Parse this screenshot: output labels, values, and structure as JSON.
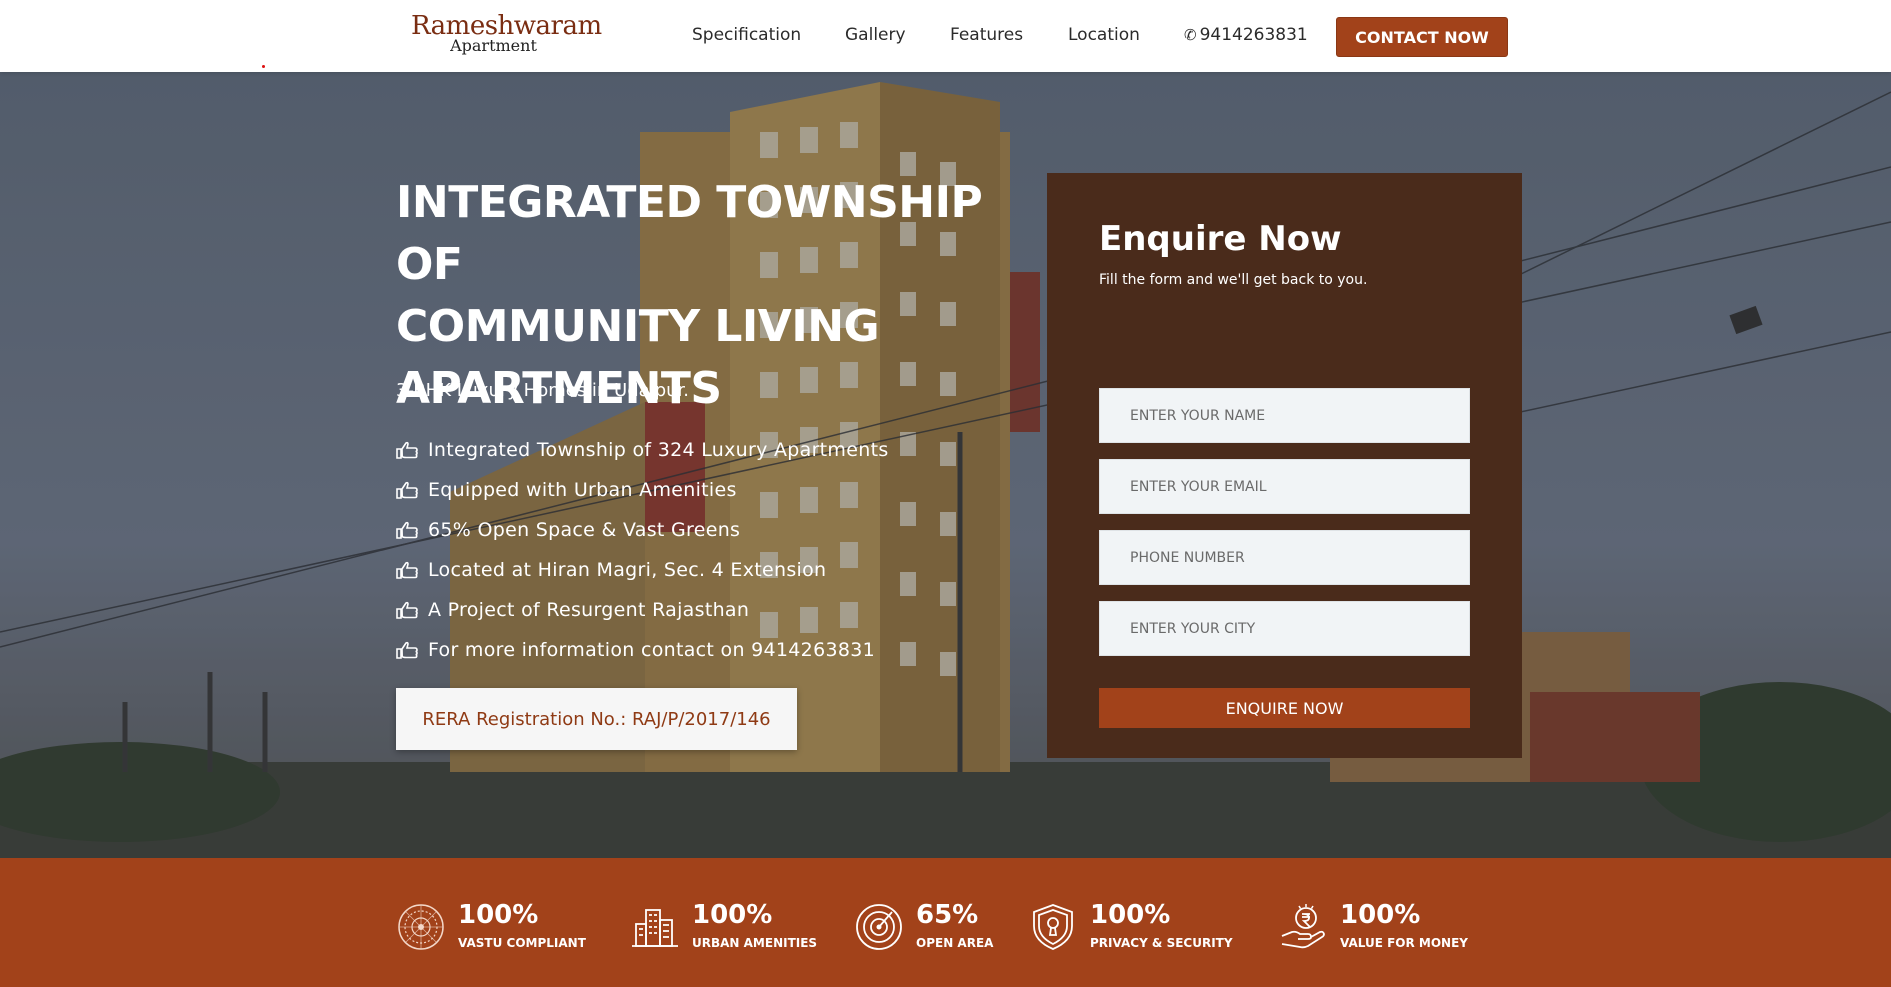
{
  "brand": {
    "name": "Rameshwaram",
    "subtitle": "Apartment"
  },
  "nav": {
    "items": [
      "Specification",
      "Gallery",
      "Features",
      "Location"
    ],
    "phone": "9414263831",
    "contact_label": "CONTACT NOW"
  },
  "hero": {
    "title_lines": [
      "INTEGRATED TOWNSHIP OF",
      "COMMUNITY LIVING",
      "APARTMENTS"
    ],
    "subtitle": "3-BHK Luxury Homes in Udaipur.",
    "features": [
      "Integrated Township of 324 Luxury Apartments",
      "Equipped with Urban Amenities",
      "65% Open Space & Vast Greens",
      "Located at Hiran Magri, Sec. 4 Extension",
      "A Project of Resurgent Rajasthan",
      "For more information contact on 9414263831"
    ],
    "feature_icon": "pointing-hand-icon",
    "rera": "RERA Registration No.: RAJ/P/2017/146"
  },
  "form": {
    "title": "Enquire Now",
    "subtitle": "Fill the form and we'll get back to you.",
    "name_placeholder": "ENTER YOUR NAME",
    "email_placeholder": "ENTER YOUR EMAIL",
    "phone_placeholder": "PHONE NUMBER",
    "city_placeholder": "ENTER YOUR CITY",
    "submit_label": "ENQUIRE NOW"
  },
  "stats": [
    {
      "value": "100%",
      "label": "VASTU COMPLIANT",
      "icon": "vastu-mandala-icon"
    },
    {
      "value": "100%",
      "label": "URBAN AMENITIES",
      "icon": "city-buildings-icon"
    },
    {
      "value": "65%",
      "label": "OPEN AREA",
      "icon": "target-area-icon"
    },
    {
      "value": "100%",
      "label": "PRIVACY & SECURITY",
      "icon": "shield-lock-icon"
    },
    {
      "value": "100%",
      "label": "VALUE FOR MONEY",
      "icon": "hand-money-icon"
    }
  ],
  "colors": {
    "accent": "#a2421a",
    "form_panel": "#4a2b1b",
    "brand_text": "#7a2d12"
  }
}
